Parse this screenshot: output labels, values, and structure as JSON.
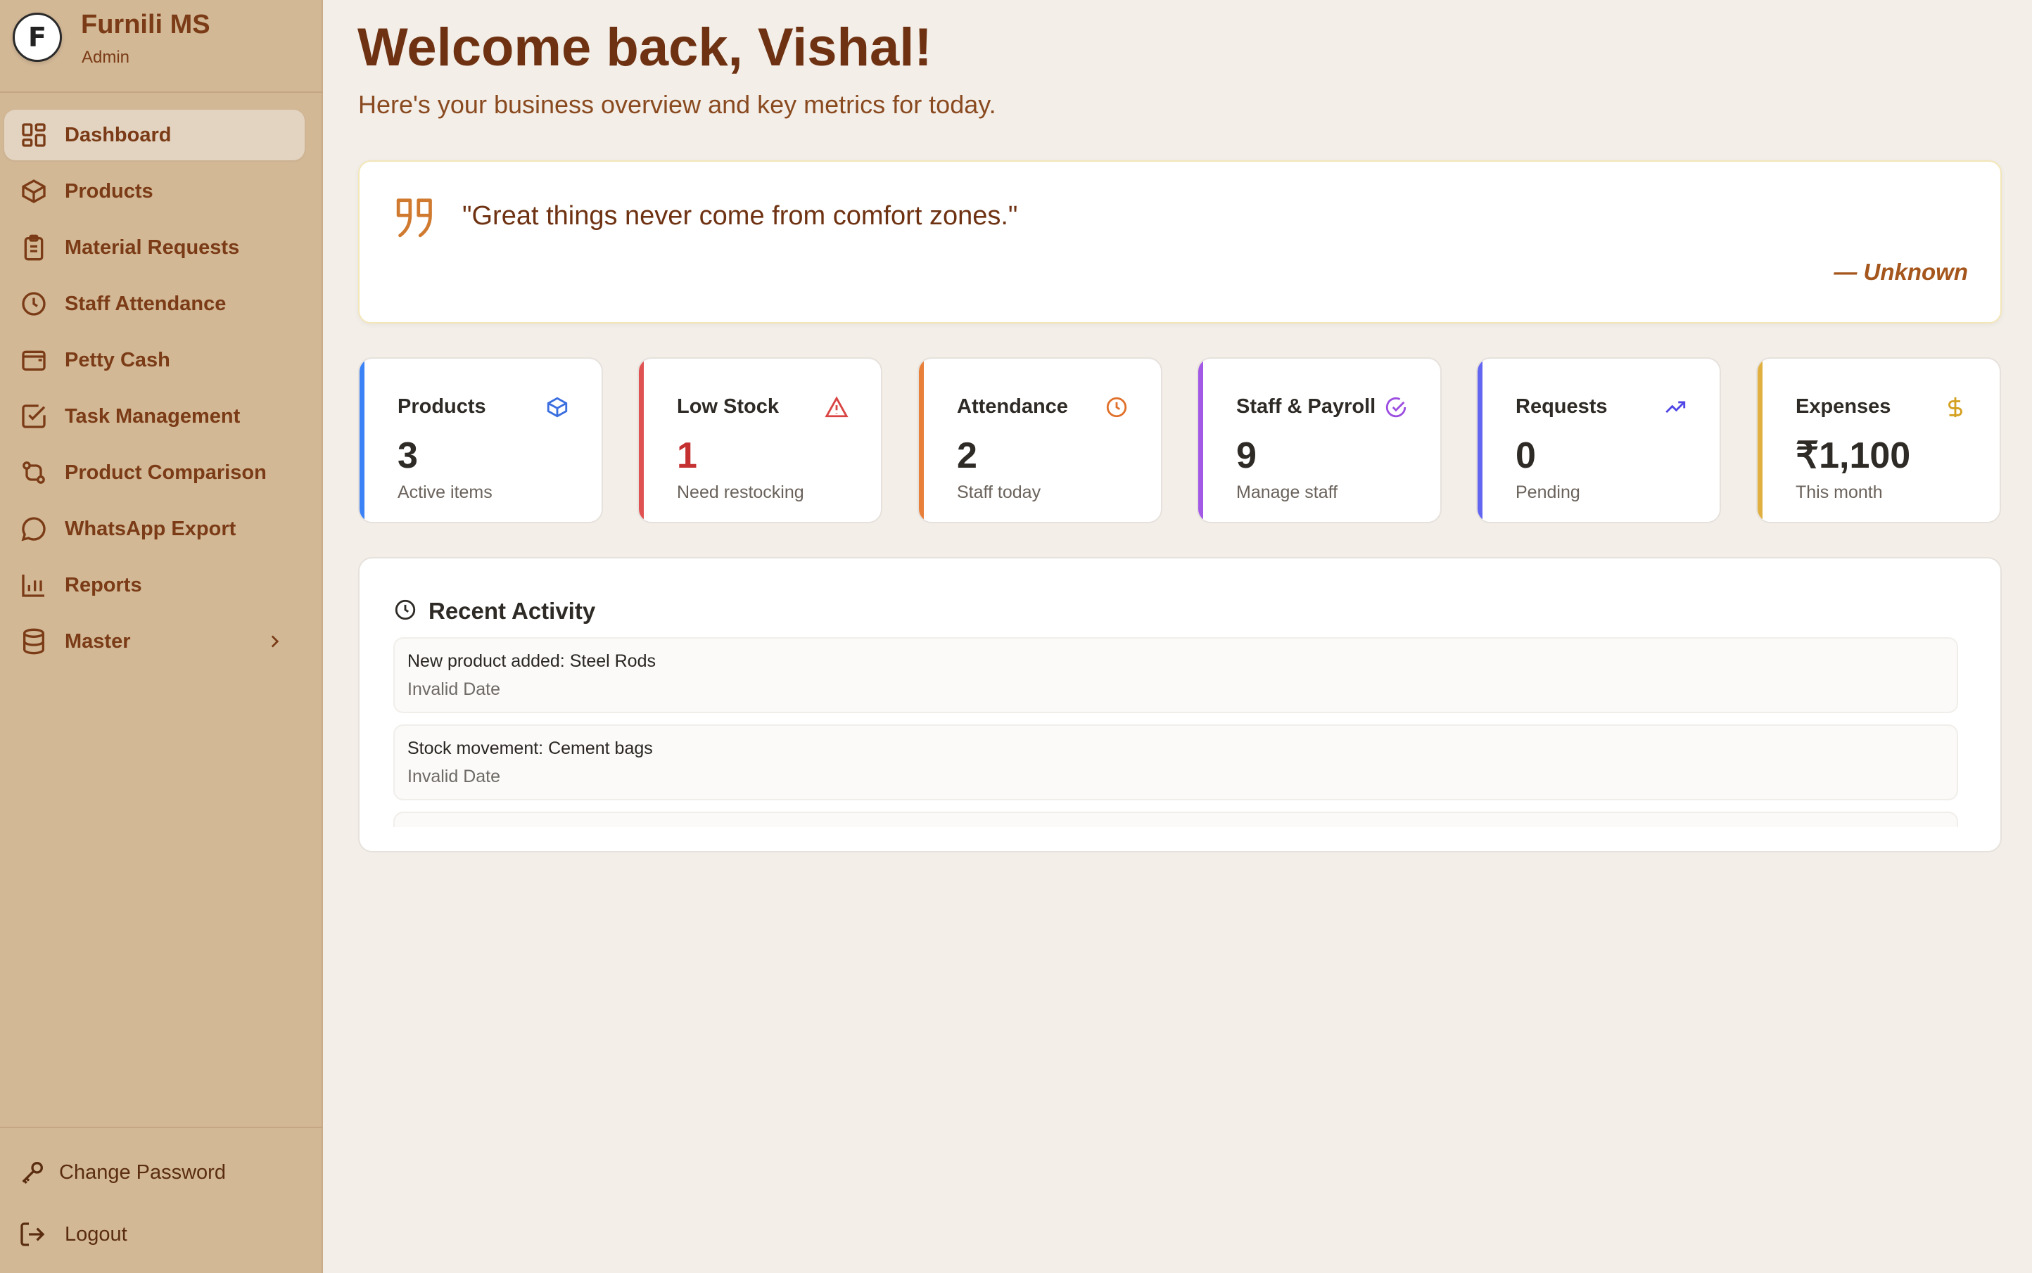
{
  "brand": {
    "logo_letter": "F",
    "title": "Furnili MS",
    "role": "Admin"
  },
  "sidebar": {
    "items": [
      {
        "label": "Dashboard",
        "icon": "dashboard-icon",
        "active": true
      },
      {
        "label": "Products",
        "icon": "box-icon"
      },
      {
        "label": "Material Requests",
        "icon": "clipboard-icon"
      },
      {
        "label": "Staff Attendance",
        "icon": "clock-icon"
      },
      {
        "label": "Petty Cash",
        "icon": "wallet-icon"
      },
      {
        "label": "Task Management",
        "icon": "check-square-icon"
      },
      {
        "label": "Product Comparison",
        "icon": "compare-icon"
      },
      {
        "label": "WhatsApp Export",
        "icon": "chat-icon"
      },
      {
        "label": "Reports",
        "icon": "bar-chart-icon"
      },
      {
        "label": "Master",
        "icon": "database-icon",
        "has_submenu": true
      }
    ],
    "bottom": {
      "change_password": "Change Password",
      "logout": "Logout"
    }
  },
  "header": {
    "welcome": "Welcome back, Vishal!",
    "subtitle": "Here's your business overview and key metrics for today."
  },
  "quote": {
    "text": "\"Great things never come from comfort zones.\"",
    "author": "— Unknown"
  },
  "stats": [
    {
      "title": "Products",
      "value": "3",
      "sub": "Active items",
      "color": "#3b82f6",
      "icon": "cube-icon"
    },
    {
      "title": "Low Stock",
      "value": "1",
      "sub": "Need restocking",
      "color": "#e05252",
      "icon": "warning-icon"
    },
    {
      "title": "Attendance",
      "value": "2",
      "sub": "Staff today",
      "color": "#e8803a",
      "icon": "clock-icon"
    },
    {
      "title": "Staff & Payroll",
      "value": "9",
      "sub": "Manage staff",
      "color": "#a259e6",
      "icon": "check-circle-icon"
    },
    {
      "title": "Requests",
      "value": "0",
      "sub": "Pending",
      "color": "#6366f1",
      "icon": "trending-up-icon"
    },
    {
      "title": "Expenses",
      "value": "₹1,100",
      "sub": "This month",
      "color": "#e0b040",
      "icon": "dollar-icon"
    }
  ],
  "activity": {
    "title": "Recent Activity",
    "items": [
      {
        "text": "New product added: Steel Rods",
        "date": "Invalid Date"
      },
      {
        "text": "Stock movement: Cement bags",
        "date": "Invalid Date"
      },
      {
        "text": "",
        "date": ""
      }
    ]
  },
  "colors": {
    "sidebar_bg": "#d3b896",
    "brand_text": "#7a3b16",
    "page_bg": "#f3eee8",
    "accent": "#a5561c"
  }
}
